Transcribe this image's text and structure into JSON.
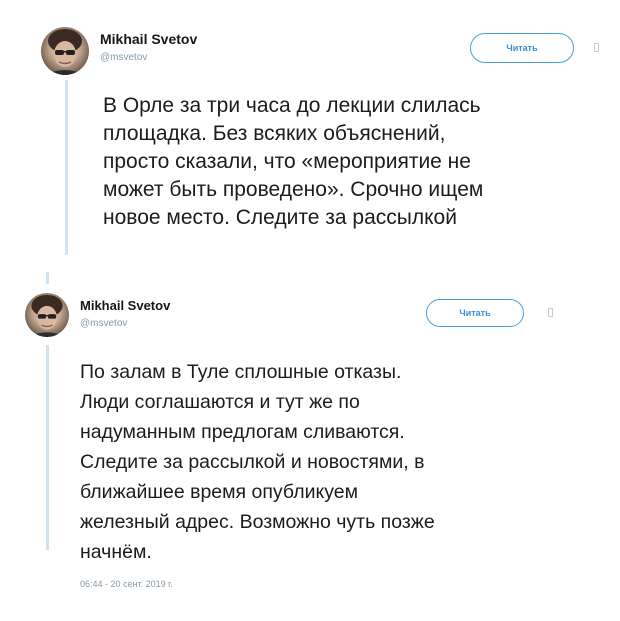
{
  "tweets": [
    {
      "author_name": "Mikhail Svetov",
      "author_handle": "@msvetov",
      "follow_label": "Читать",
      "text": "В Орле за три часа до лекции слилась\nплощадка. Без всяких объяснений,\nпросто сказали, что «мероприятие не\nможет быть проведено». Срочно ищем\nновое место. Следите за рассылкой"
    },
    {
      "author_name": "Mikhail Svetov",
      "author_handle": "@msvetov",
      "follow_label": "Читать",
      "text": "По залам в Туле сплошные отказы.\nЛюди соглашаются и тут же по\nнадуманным предлогам сливаются.\nСледите за рассылкой и новостями, в\nближайшее время опубликуем\nжелезный адрес. Возможно чуть позже\nначнём.",
      "timestamp": "06:44 - 20 сент. 2019 г."
    }
  ],
  "colors": {
    "accent": "#4a9fe0",
    "thread_line": "#cfe3f2",
    "muted": "#8899a6"
  }
}
